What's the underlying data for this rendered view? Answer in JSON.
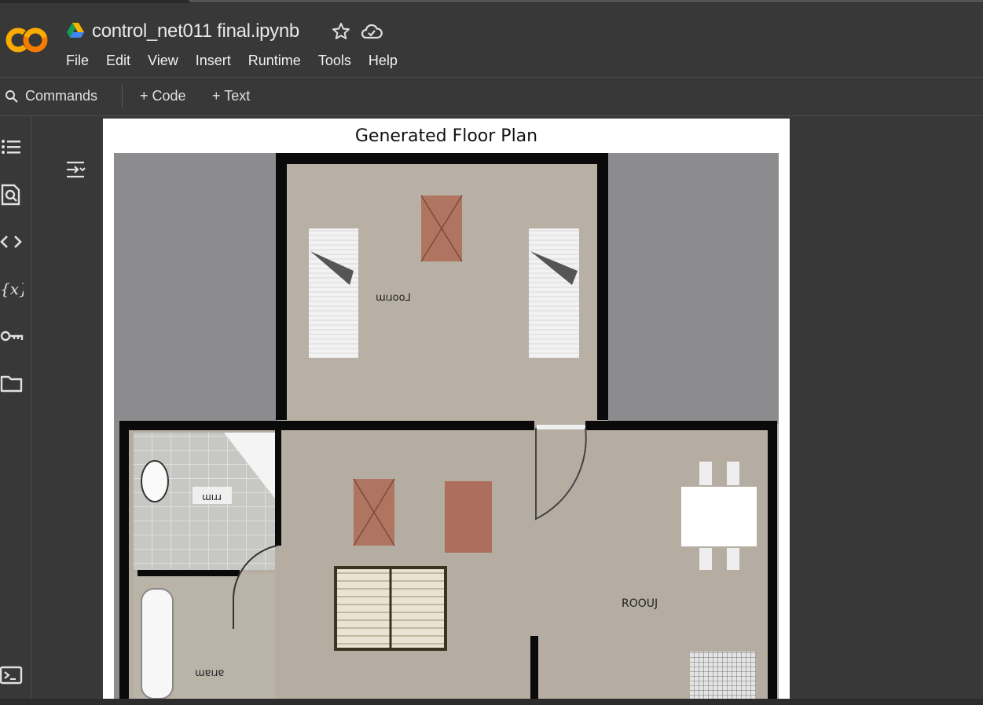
{
  "notebook": {
    "title": "control_net011 final.ipynb",
    "logo_text": "CO"
  },
  "menu": [
    "File",
    "Edit",
    "View",
    "Insert",
    "Runtime",
    "Tools",
    "Help"
  ],
  "toolbar": {
    "commands_label": "Commands",
    "add_code_label": "+ Code",
    "add_text_label": "+ Text"
  },
  "left_rail_icons": [
    "table-of-contents-icon",
    "find-icon",
    "code-snippets-icon",
    "variables-icon",
    "secrets-key-icon",
    "files-folder-icon",
    "terminal-icon"
  ],
  "output": {
    "plot_title": "Generated Floor Plan",
    "image_labels": {
      "room_top": "ɯıɹoo⅃",
      "bath": "ɯıɹɹ",
      "bath2": "ɯɐıɹɐ",
      "room_right": "ROOUJ"
    }
  },
  "colors": {
    "background": "#383838",
    "accent_orange": "#f9a825",
    "floor": "#b5ada2",
    "wall": "#0a0a0a",
    "outside": "#8a8a8c"
  }
}
